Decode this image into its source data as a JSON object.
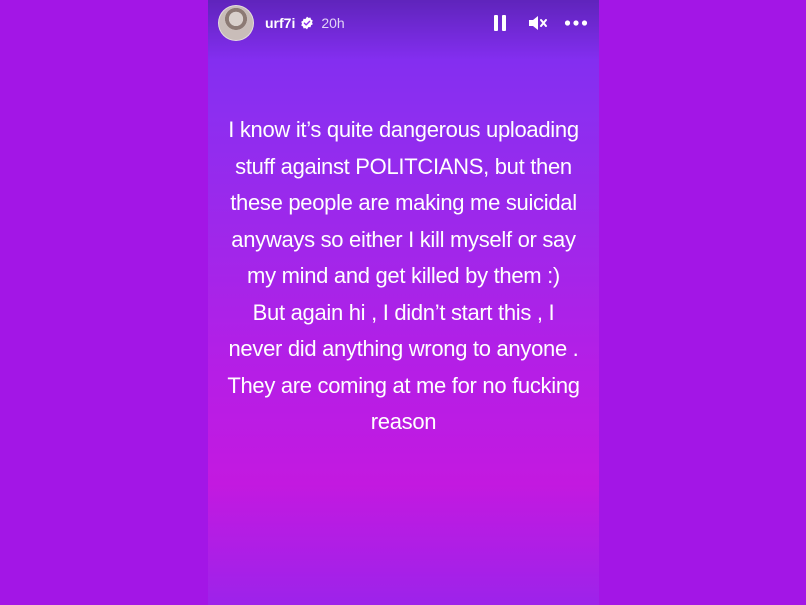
{
  "header": {
    "username": "urf7i",
    "time": "20h",
    "verified_icon": "verified-badge-icon",
    "controls": [
      "pause-icon",
      "mute-icon",
      "more-icon"
    ]
  },
  "story": {
    "lines": [
      "I know it’s quite dangerous uploading",
      "stuff against POLITCIANS, but then",
      "these people are making me suicidal",
      "anyways so either I kill myself or say",
      "my mind and get killed by them :)",
      "But again hi , I didn’t start this , I",
      "never did anything wrong to anyone .",
      "They are coming at me for no fucking",
      "reason"
    ]
  },
  "colors": {
    "page_background": "#a316e6",
    "gradient_top": "#7a2ef0",
    "gradient_bottom": "#c319e0",
    "text": "#ffffff"
  }
}
